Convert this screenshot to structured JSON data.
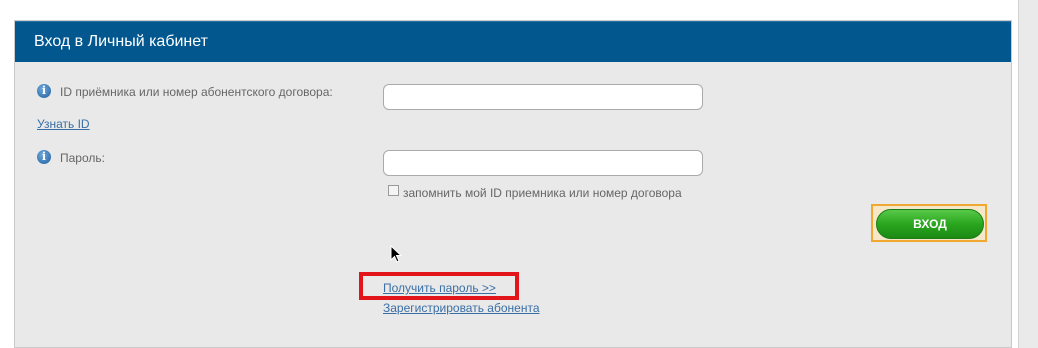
{
  "panel": {
    "title": "Вход в Личный кабинет"
  },
  "form": {
    "id_label": "ID приёмника или номер абонентского договора:",
    "id_value": "",
    "find_id_link": "Узнать ID",
    "password_label": "Пароль:",
    "password_value": "",
    "remember_label": "запомнить мой ID приемника или номер договора",
    "remember_checked": false,
    "submit_label": "ВХОД",
    "get_password_link": "Получить пароль >>",
    "register_link": "Зарегистрировать абонента"
  },
  "icons": {
    "info": "info-icon",
    "cursor": "mouse-cursor-icon"
  },
  "colors": {
    "header_bg": "#02578f",
    "button_green": "#2aa61f",
    "highlight_red": "#e4141b",
    "button_focus_border": "#f0a830"
  }
}
